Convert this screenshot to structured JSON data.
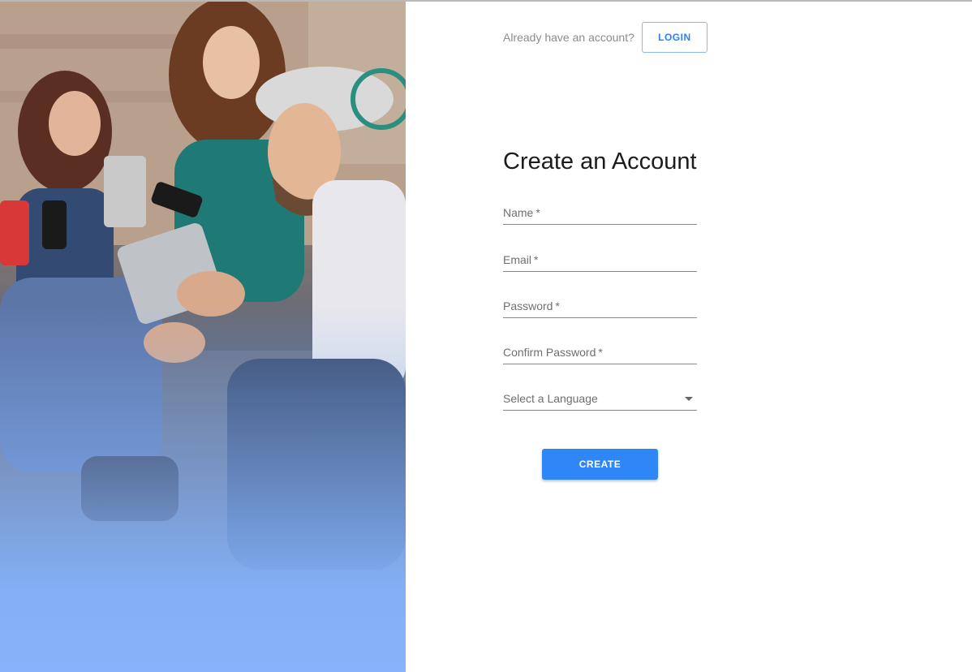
{
  "header": {
    "prompt": "Already have an account?",
    "login_label": "LOGIN"
  },
  "form": {
    "title": "Create an Account",
    "fields": [
      {
        "label": "Name",
        "required_mark": "*"
      },
      {
        "label": "Email",
        "required_mark": "*"
      },
      {
        "label": "Password",
        "required_mark": "*"
      },
      {
        "label": "Confirm Password",
        "required_mark": "*"
      }
    ],
    "language_select": {
      "placeholder": "Select a Language",
      "icon": "chevron-down-icon"
    },
    "submit_label": "CREATE"
  },
  "colors": {
    "accent": "#2f86f6",
    "login_border": "#90b8f0",
    "hero_gradient_bottom": "#86b3fb"
  }
}
